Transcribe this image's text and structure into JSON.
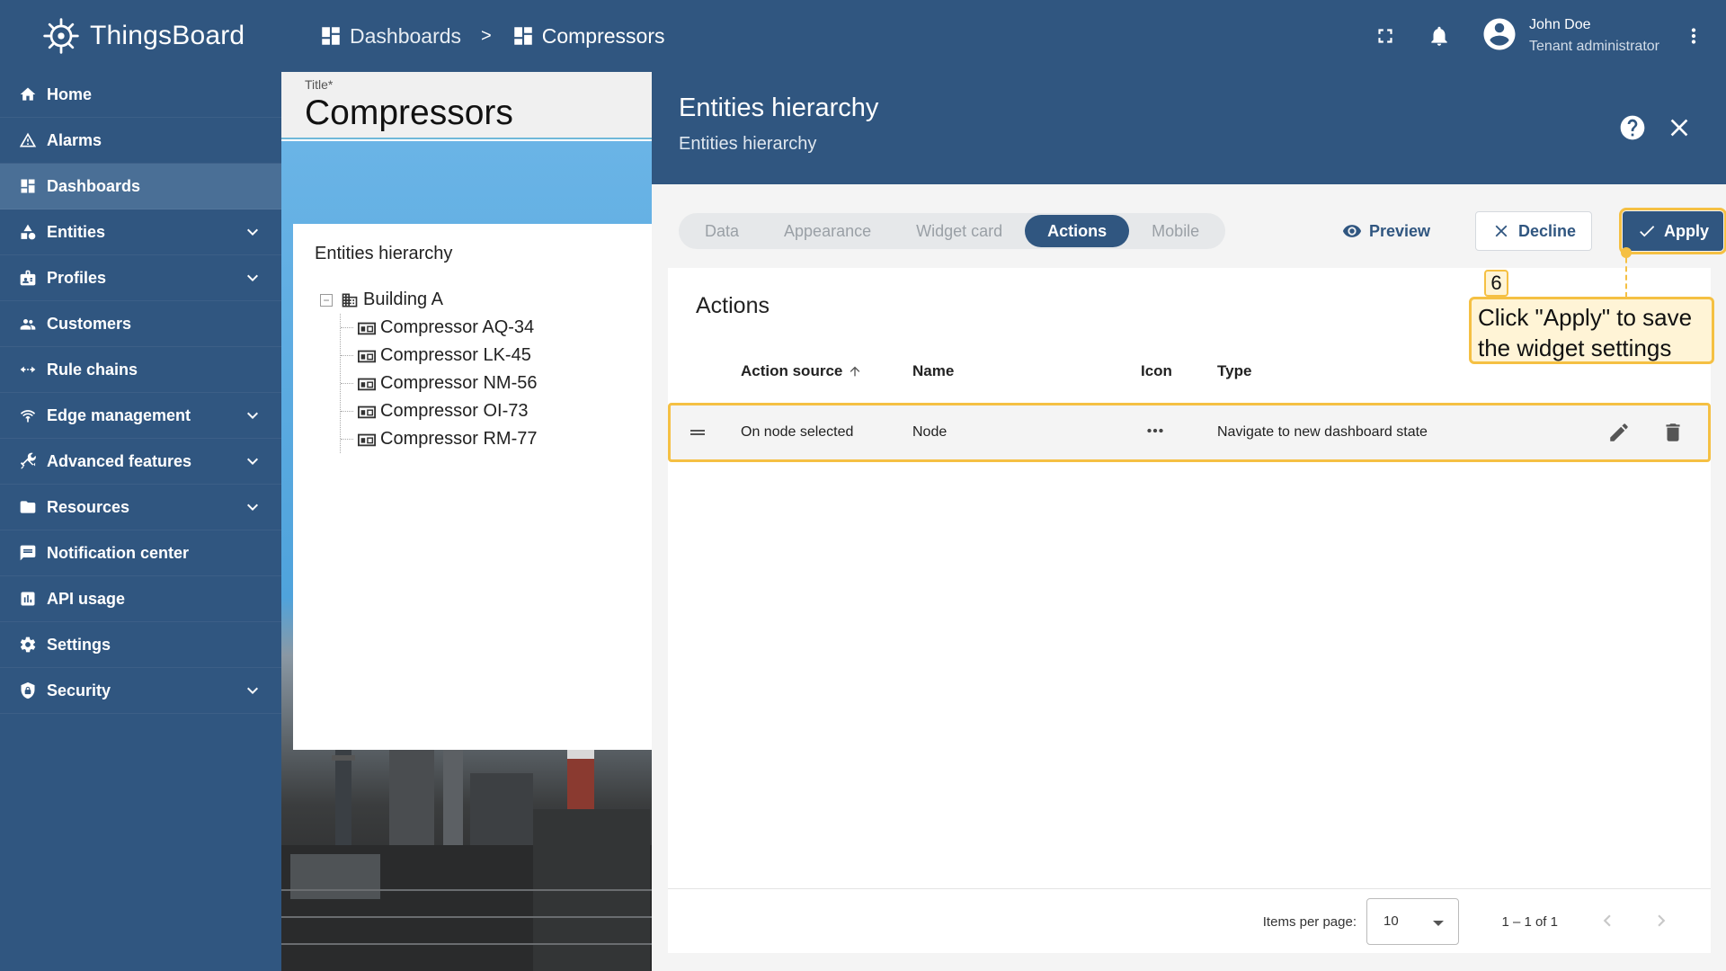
{
  "app": {
    "name": "ThingsBoard"
  },
  "sidebar": {
    "items": [
      {
        "label": "Home",
        "icon": "home-icon",
        "expandable": false,
        "active": false
      },
      {
        "label": "Alarms",
        "icon": "alarm-warning-icon",
        "expandable": false,
        "active": false
      },
      {
        "label": "Dashboards",
        "icon": "dashboards-icon",
        "expandable": false,
        "active": true
      },
      {
        "label": "Entities",
        "icon": "entities-icon",
        "expandable": true,
        "active": false
      },
      {
        "label": "Profiles",
        "icon": "profiles-icon",
        "expandable": true,
        "active": false
      },
      {
        "label": "Customers",
        "icon": "customers-icon",
        "expandable": false,
        "active": false
      },
      {
        "label": "Rule chains",
        "icon": "rule-chains-icon",
        "expandable": false,
        "active": false
      },
      {
        "label": "Edge management",
        "icon": "edge-icon",
        "expandable": true,
        "active": false
      },
      {
        "label": "Advanced features",
        "icon": "tools-icon",
        "expandable": true,
        "active": false
      },
      {
        "label": "Resources",
        "icon": "folder-icon",
        "expandable": true,
        "active": false
      },
      {
        "label": "Notification center",
        "icon": "notification-center-icon",
        "expandable": false,
        "active": false
      },
      {
        "label": "API usage",
        "icon": "api-usage-icon",
        "expandable": false,
        "active": false
      },
      {
        "label": "Settings",
        "icon": "gear-icon",
        "expandable": false,
        "active": false
      },
      {
        "label": "Security",
        "icon": "shield-icon",
        "expandable": true,
        "active": false
      }
    ]
  },
  "topbar": {
    "breadcrumb": [
      {
        "label": "Dashboards"
      },
      {
        "label": "Compressors"
      }
    ],
    "separator": ">",
    "user": {
      "name": "John Doe",
      "role": "Tenant administrator"
    }
  },
  "dashboard": {
    "title_label": "Title*",
    "title_value": "Compressors",
    "widget": {
      "title": "Entities hierarchy",
      "root": "Building A",
      "children": [
        "Compressor AQ-34",
        "Compressor LK-45",
        "Compressor NM-56",
        "Compressor OI-73",
        "Compressor RM-77"
      ]
    }
  },
  "panel": {
    "title": "Entities hierarchy",
    "subtitle": "Entities hierarchy",
    "tabs": [
      {
        "label": "Data",
        "active": false
      },
      {
        "label": "Appearance",
        "active": false
      },
      {
        "label": "Widget card",
        "active": false
      },
      {
        "label": "Actions",
        "active": true
      },
      {
        "label": "Mobile",
        "active": false
      }
    ],
    "preview_label": "Preview",
    "decline_label": "Decline",
    "apply_label": "Apply",
    "actions": {
      "title": "Actions",
      "columns": {
        "source": "Action source",
        "name": "Name",
        "icon": "Icon",
        "type": "Type"
      },
      "rows": [
        {
          "source": "On node selected",
          "name": "Node",
          "icon": "more-horiz-icon",
          "type": "Navigate to new dashboard state"
        }
      ]
    },
    "paginator": {
      "items_per_page_label": "Items per page:",
      "page_size": "10",
      "range": "1 – 1 of 1"
    }
  },
  "callout": {
    "step": "6",
    "text": "Click \"Apply\" to save the widget settings"
  },
  "colors": {
    "primary": "#305680",
    "highlight": "#f5c043",
    "callout_bg": "#fff4d6"
  }
}
